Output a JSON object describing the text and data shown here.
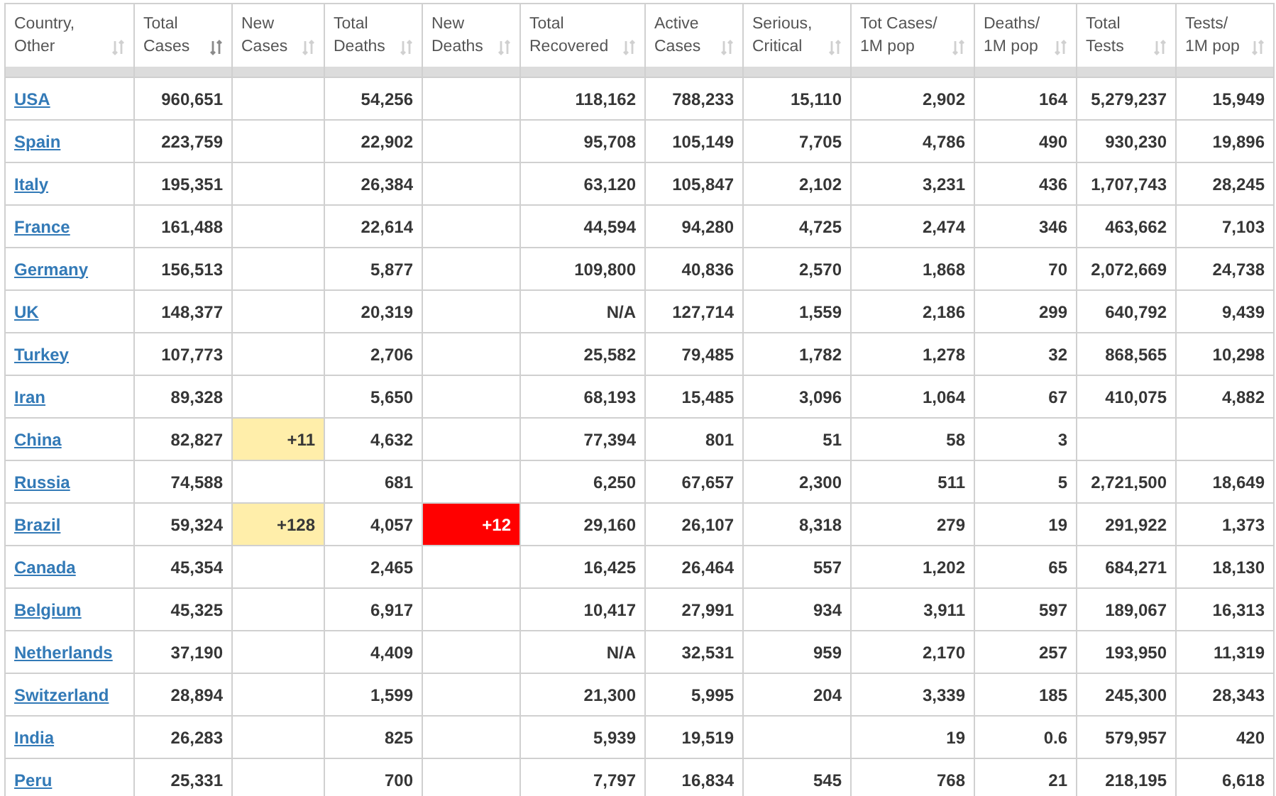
{
  "table": {
    "columns": [
      {
        "label": "Country, Other",
        "sorted": false,
        "kind": "link"
      },
      {
        "label": "Total Cases",
        "sorted": true,
        "kind": "plain"
      },
      {
        "label": "New Cases",
        "sorted": false,
        "kind": "new_cases"
      },
      {
        "label": "Total Deaths",
        "sorted": false,
        "kind": "plain"
      },
      {
        "label": "New Deaths",
        "sorted": false,
        "kind": "new_deaths"
      },
      {
        "label": "Total Recovered",
        "sorted": false,
        "kind": "plain"
      },
      {
        "label": "Active Cases",
        "sorted": false,
        "kind": "plain"
      },
      {
        "label": "Serious, Critical",
        "sorted": false,
        "kind": "plain"
      },
      {
        "label": "Tot Cases/ 1M pop",
        "sorted": false,
        "kind": "plain"
      },
      {
        "label": "Deaths/ 1M pop",
        "sorted": false,
        "kind": "plain"
      },
      {
        "label": "Total Tests",
        "sorted": false,
        "kind": "plain"
      },
      {
        "label": "Tests/ 1M pop",
        "sorted": false,
        "kind": "plain"
      }
    ],
    "rows": [
      {
        "cells": [
          "USA",
          "960,651",
          null,
          "54,256",
          null,
          "118,162",
          "788,233",
          "15,110",
          "2,902",
          "164",
          "5,279,237",
          "15,949"
        ]
      },
      {
        "cells": [
          "Spain",
          "223,759",
          null,
          "22,902",
          null,
          "95,708",
          "105,149",
          "7,705",
          "4,786",
          "490",
          "930,230",
          "19,896"
        ]
      },
      {
        "cells": [
          "Italy",
          "195,351",
          null,
          "26,384",
          null,
          "63,120",
          "105,847",
          "2,102",
          "3,231",
          "436",
          "1,707,743",
          "28,245"
        ]
      },
      {
        "cells": [
          "France",
          "161,488",
          null,
          "22,614",
          null,
          "44,594",
          "94,280",
          "4,725",
          "2,474",
          "346",
          "463,662",
          "7,103"
        ]
      },
      {
        "cells": [
          "Germany",
          "156,513",
          null,
          "5,877",
          null,
          "109,800",
          "40,836",
          "2,570",
          "1,868",
          "70",
          "2,072,669",
          "24,738"
        ]
      },
      {
        "cells": [
          "UK",
          "148,377",
          null,
          "20,319",
          null,
          "N/A",
          "127,714",
          "1,559",
          "2,186",
          "299",
          "640,792",
          "9,439"
        ]
      },
      {
        "cells": [
          "Turkey",
          "107,773",
          null,
          "2,706",
          null,
          "25,582",
          "79,485",
          "1,782",
          "1,278",
          "32",
          "868,565",
          "10,298"
        ]
      },
      {
        "cells": [
          "Iran",
          "89,328",
          null,
          "5,650",
          null,
          "68,193",
          "15,485",
          "3,096",
          "1,064",
          "67",
          "410,075",
          "4,882"
        ]
      },
      {
        "cells": [
          "China",
          "82,827",
          "+11",
          "4,632",
          null,
          "77,394",
          "801",
          "51",
          "58",
          "3",
          null,
          null
        ]
      },
      {
        "cells": [
          "Russia",
          "74,588",
          null,
          "681",
          null,
          "6,250",
          "67,657",
          "2,300",
          "511",
          "5",
          "2,721,500",
          "18,649"
        ]
      },
      {
        "cells": [
          "Brazil",
          "59,324",
          "+128",
          "4,057",
          "+12",
          "29,160",
          "26,107",
          "8,318",
          "279",
          "19",
          "291,922",
          "1,373"
        ]
      },
      {
        "cells": [
          "Canada",
          "45,354",
          null,
          "2,465",
          null,
          "16,425",
          "26,464",
          "557",
          "1,202",
          "65",
          "684,271",
          "18,130"
        ]
      },
      {
        "cells": [
          "Belgium",
          "45,325",
          null,
          "6,917",
          null,
          "10,417",
          "27,991",
          "934",
          "3,911",
          "597",
          "189,067",
          "16,313"
        ]
      },
      {
        "cells": [
          "Netherlands",
          "37,190",
          null,
          "4,409",
          null,
          "N/A",
          "32,531",
          "959",
          "2,170",
          "257",
          "193,950",
          "11,319"
        ]
      },
      {
        "cells": [
          "Switzerland",
          "28,894",
          null,
          "1,599",
          null,
          "21,300",
          "5,995",
          "204",
          "3,339",
          "185",
          "245,300",
          "28,343"
        ]
      },
      {
        "cells": [
          "India",
          "26,283",
          null,
          "825",
          null,
          "5,939",
          "19,519",
          null,
          "19",
          "0.6",
          "579,957",
          "420"
        ]
      },
      {
        "cells": [
          "Peru",
          "25,331",
          null,
          "700",
          null,
          "7,797",
          "16,834",
          "545",
          "768",
          "21",
          "218,195",
          "6,618"
        ]
      }
    ]
  }
}
